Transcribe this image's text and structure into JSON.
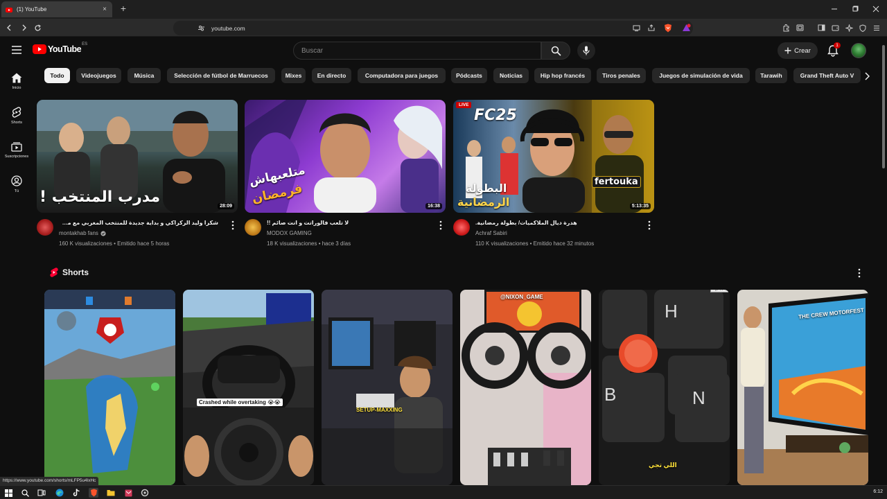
{
  "browser": {
    "tab_title": "(1) YouTube",
    "url": "youtube.com",
    "status_url": "https://www.youtube.com/shorts/mLFP5u4lxHc"
  },
  "header": {
    "logo_text": "YouTube",
    "country_code": "ES",
    "search_placeholder": "Buscar",
    "create_label": "Crear",
    "notifications_count": "1"
  },
  "sidebar": {
    "items": [
      {
        "label": "Inicio",
        "icon": "home-icon"
      },
      {
        "label": "Shorts",
        "icon": "shorts-icon"
      },
      {
        "label": "Suscripciones",
        "icon": "subscriptions-icon"
      },
      {
        "label": "Tú",
        "icon": "you-icon"
      }
    ]
  },
  "chips": [
    "Todo",
    "Videojuegos",
    "Música",
    "Selección de fútbol de Marruecos",
    "Mixes",
    "En directo",
    "Computadora para juegos",
    "Pódcasts",
    "Noticias",
    "Hip hop francés",
    "Tiros penales",
    "Juegos de simulación de vida",
    "Tarawih",
    "Grand Theft Auto V"
  ],
  "videos": [
    {
      "title": "شكرا وليد الركراكي و بداية جديدة للمنتخب المغربي مع محمد وهبي",
      "channel": "montakhab fans",
      "verified": true,
      "stats": "160 K visualizaciones • Emitido hace 5 horas",
      "duration": "28:09",
      "thumb_text": "مدرب المنتخب !"
    },
    {
      "title": "لا تلعب فالوراتت و انت صائم !!",
      "channel": "MODOX GAMING",
      "verified": false,
      "stats": "18 K visualizaciones • hace 3 días",
      "duration": "16:38",
      "thumb_text_1": "متلعبهاش",
      "thumb_text_2": "فرمضان"
    },
    {
      "title": "هدرة ديال الملاكميات/ بطولة رمضانية.",
      "channel": "Achraf Sabiri",
      "verified": false,
      "stats": "110 K visualizaciones • Emitido hace 32 minutos",
      "duration": "5:13:35",
      "live_label": "LIVE",
      "thumb_game": "FC25",
      "thumb_name": "fertouka",
      "thumb_text_1": "البطولة",
      "thumb_text_2": "الرمضانية"
    }
  ],
  "shorts": {
    "title": "Shorts",
    "items": [
      {
        "caption": ""
      },
      {
        "caption": "Crashed while overtaking 😭😭"
      },
      {
        "caption": "SETUP-MAXXING"
      },
      {
        "caption": "@NIXON_GAME"
      },
      {
        "caption": "اللي تجي"
      },
      {
        "caption": "THE CREW MOTORFEST"
      }
    ]
  },
  "taskbar": {
    "time": "6:12"
  }
}
